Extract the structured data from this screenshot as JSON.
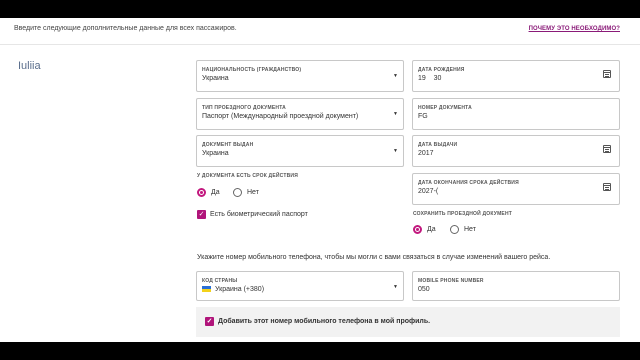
{
  "header": {
    "intro": "Введите следующие дополнительные данные для всех пассажиров.",
    "why_link": "ПОЧЕМУ ЭТО НЕОБХОДИМО?"
  },
  "passenger": {
    "name": "Iuliia"
  },
  "fields": {
    "nationality": {
      "label": "НАЦИОНАЛЬНОСТЬ (ГРАЖДАНСТВО)",
      "value": "Украина"
    },
    "birth_date": {
      "label": "ДАТА РОЖДЕНИЯ",
      "value": "19    30"
    },
    "doc_type": {
      "label": "ТИП ПРОЕЗДНОГО ДОКУМЕНТА",
      "value": "Паспорт (Международный проездной документ)"
    },
    "doc_number": {
      "label": "НОМЕР ДОКУМЕНТА",
      "value": "FG"
    },
    "issued_by": {
      "label": "ДОКУМЕНТ ВЫДАН",
      "value": "Украина"
    },
    "issue_date": {
      "label": "ДАТА ВЫДАЧИ",
      "value": "2017"
    },
    "expiry_date": {
      "label": "ДАТА ОКОНЧАНИЯ СРОКА ДЕЙСТВИЯ",
      "value": "2027-("
    }
  },
  "expiry_question": {
    "title": "У ДОКУМЕНТА ЕСТЬ СРОК ДЕЙСТВИЯ",
    "yes": "Да",
    "no": "Нет",
    "selected": "yes"
  },
  "biometric": {
    "label": "Есть биометрический паспорт",
    "checked": true
  },
  "save_doc": {
    "title": "СОХРАНИТЬ ПРОЕЗДНОЙ ДОКУМЕНТ",
    "yes": "Да",
    "no": "Нет",
    "selected": "yes"
  },
  "phone_note": "Укажите номер мобильного телефона, чтобы мы могли с вами связаться в случае изменений вашего рейса.",
  "country_code": {
    "label": "КОД СТРАНЫ",
    "value": "Украина (+380)"
  },
  "mobile": {
    "label": "MOBILE PHONE NUMBER",
    "value": "050"
  },
  "add_profile": {
    "label": "Добавить этот номер мобильного телефона в мой профиль.",
    "checked": true
  },
  "colors": {
    "accent": "#c2187e",
    "link": "#8a1a78",
    "name": "#5a6e8c"
  }
}
